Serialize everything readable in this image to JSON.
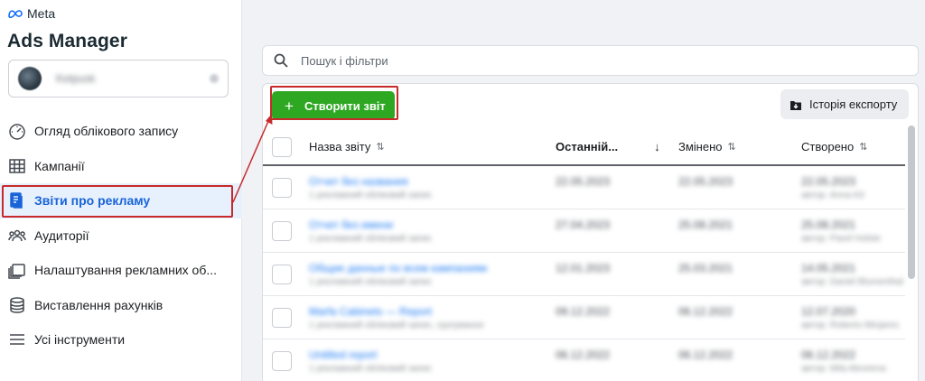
{
  "brand": {
    "logo_text": "Meta",
    "app_title": "Ads Manager"
  },
  "account": {
    "name": "Ketpusk"
  },
  "nav": [
    {
      "label": "Огляд облікового запису",
      "icon": "dashboard-icon"
    },
    {
      "label": "Кампанії",
      "icon": "table-icon"
    },
    {
      "label": "Звіти про рекламу",
      "icon": "reports-icon",
      "active": true
    },
    {
      "label": "Аудиторії",
      "icon": "audience-icon"
    },
    {
      "label": "Налаштування рекламних об...",
      "icon": "ad-settings-icon"
    },
    {
      "label": "Виставлення рахунків",
      "icon": "billing-icon"
    },
    {
      "label": "Усі інструменти",
      "icon": "menu-icon"
    }
  ],
  "search": {
    "placeholder": "Пошук і фільтри"
  },
  "toolbar": {
    "create_label": "Створити звіт",
    "export_label": "Історія експорту"
  },
  "table": {
    "headers": [
      "Назва звіту",
      "Останній...",
      "Змінено",
      "Створено"
    ],
    "rows": [
      {
        "name": "Отчет без названия",
        "sub": "1 рекламний обліковий запис",
        "last": "22.05.2023",
        "changed": "22.05.2023",
        "created": "22.05.2023",
        "author": "автор: Anna Kit"
      },
      {
        "name": "Отчет без имени",
        "sub": "1 рекламний обліковий запис",
        "last": "27.04.2023",
        "changed": "25.08.2021",
        "created": "25.08.2021",
        "author": "автор: Pavel Holste"
      },
      {
        "name": "Общие данные по всем кампаниям",
        "sub": "1 рекламний обліковий запис",
        "last": "12.01.2023",
        "changed": "25.03.2021",
        "created": "14.05.2021",
        "author": "автор: Daniel Blumenthal"
      },
      {
        "name": "Marfa Cabinets — Report",
        "sub": "1 рекламний обліковий запис, групування",
        "last": "09.12.2022",
        "changed": "06.12.2022",
        "created": "12.07.2020",
        "author": "автор: Roberto Minjares"
      },
      {
        "name": "Untitled report",
        "sub": "1 рекламний обліковий запис",
        "last": "06.12.2022",
        "changed": "06.12.2022",
        "created": "06.12.2022",
        "author": "автор: Mila Alexeeva"
      }
    ]
  },
  "colors": {
    "accent_green": "#2ea823",
    "active_blue": "#1864d8",
    "annotation_red": "#c72a2a"
  }
}
